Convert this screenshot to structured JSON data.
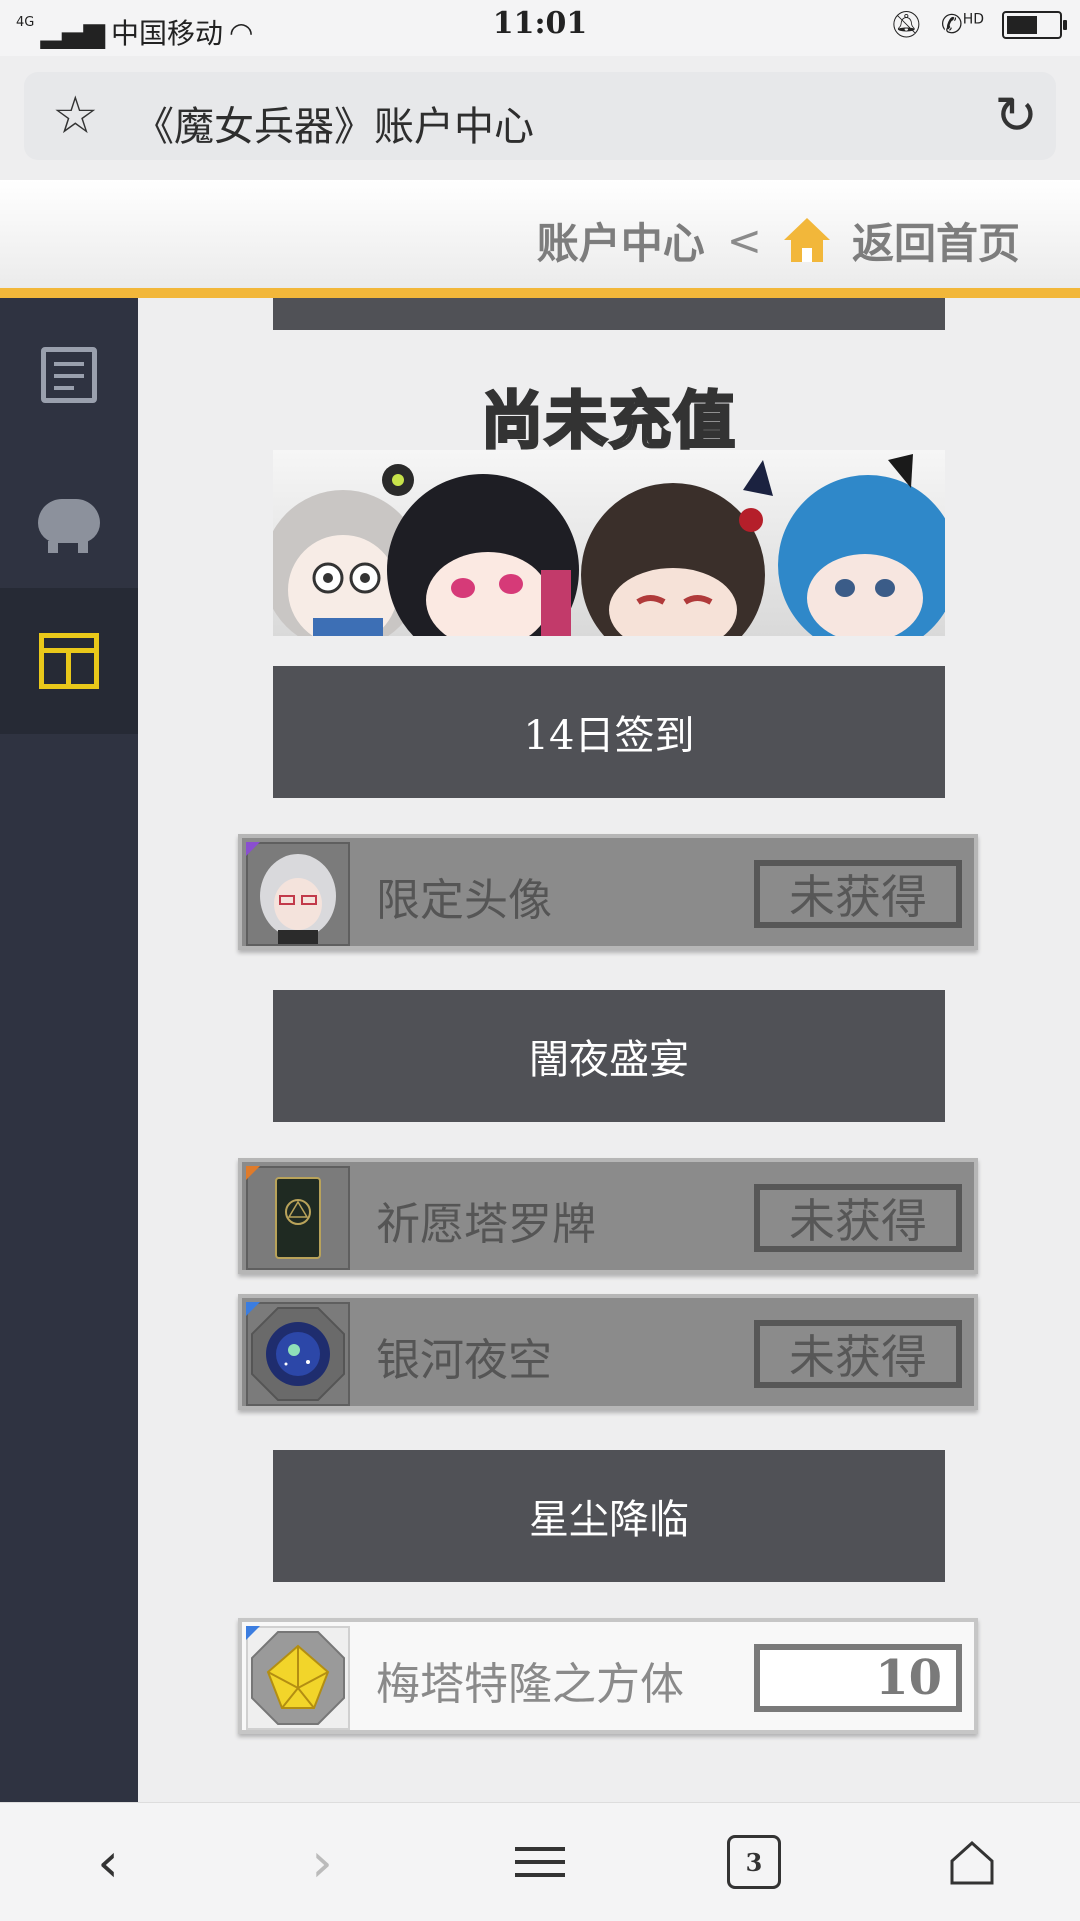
{
  "status_bar": {
    "network": "4G",
    "carrier": "中国移动",
    "time": "11:01",
    "hd": "HD"
  },
  "browser": {
    "page_title": "《魔女兵器》账户中心",
    "tab_count": "3"
  },
  "site_header": {
    "account_center": "账户中心",
    "separator": "<",
    "home_link": "返回首页",
    "accent_color": "#f2b73a"
  },
  "sidebar": {
    "items": [
      {
        "icon": "notes-icon"
      },
      {
        "icon": "piggy-bank-icon"
      },
      {
        "icon": "layout-icon",
        "active": true
      }
    ]
  },
  "banner": {
    "title": "尚未充值"
  },
  "sections": [
    {
      "label": "14日签到",
      "rewards": [
        {
          "name": "限定头像",
          "status": "未获得",
          "corner_color": "#8a4fd0"
        }
      ]
    },
    {
      "label": "闇夜盛宴",
      "rewards": [
        {
          "name": "祈愿塔罗牌",
          "status": "未获得",
          "corner_color": "#e07b2a"
        },
        {
          "name": "银河夜空",
          "status": "未获得",
          "corner_color": "#3b7de0"
        }
      ]
    },
    {
      "label": "星尘降临",
      "rewards": [
        {
          "name": "梅塔特隆之方体",
          "status": "10",
          "corner_color": "#3b7de0"
        }
      ]
    }
  ]
}
